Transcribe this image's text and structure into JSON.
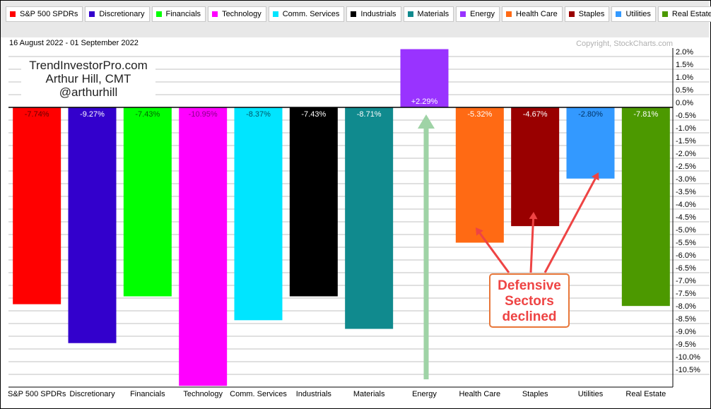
{
  "legend": [
    {
      "label": "S&P 500 SPDRs",
      "color": "#ff0000"
    },
    {
      "label": "Discretionary",
      "color": "#3300cc"
    },
    {
      "label": "Financials",
      "color": "#00ff00"
    },
    {
      "label": "Technology",
      "color": "#ff00ff"
    },
    {
      "label": "Comm. Services",
      "color": "#00e5ff"
    },
    {
      "label": "Industrials",
      "color": "#000000"
    },
    {
      "label": "Materials",
      "color": "#108a8e"
    },
    {
      "label": "Energy",
      "color": "#9933ff"
    },
    {
      "label": "Health Care",
      "color": "#ff6a14"
    },
    {
      "label": "Staples",
      "color": "#990000"
    },
    {
      "label": "Utilities",
      "color": "#3399ff"
    },
    {
      "label": "Real Estate",
      "color": "#4c9900"
    }
  ],
  "header": {
    "date_range": "16 August 2022 - 01 September 2022",
    "copyright": "Copyright, StockCharts.com"
  },
  "watermark": {
    "line1": "TrendInvestorPro.com",
    "line2": "Arthur Hill, CMT",
    "line3": "@arthurhill"
  },
  "annotation": {
    "line1": "Defensive",
    "line2": "Sectors",
    "line3": "declined",
    "color": "#ee4444"
  },
  "chart_data": {
    "type": "bar",
    "title": "",
    "xlabel": "",
    "ylabel": "",
    "categories": [
      "S&P 500 SPDRs",
      "Discretionary",
      "Financials",
      "Technology",
      "Comm. Services",
      "Industrials",
      "Materials",
      "Energy",
      "Health Care",
      "Staples",
      "Utilities",
      "Real Estate"
    ],
    "values": [
      -7.74,
      -9.27,
      -7.43,
      -10.95,
      -8.37,
      -7.43,
      -8.71,
      2.29,
      -5.32,
      -4.67,
      -2.8,
      -7.81
    ],
    "value_labels": [
      "-7.74%",
      "-9.27%",
      "-7.43%",
      "-10.95%",
      "-8.37%",
      "-7.43%",
      "-8.71%",
      "+2.29%",
      "-5.32%",
      "-4.67%",
      "-2.80%",
      "-7.81%"
    ],
    "label_colors": [
      "#660000",
      "#ffffff",
      "#006600",
      "#880088",
      "#005566",
      "#ffffff",
      "#ffffff",
      "#ffffff",
      "#ffffff",
      "#ffffff",
      "#003366",
      "#ffffff"
    ],
    "colors": [
      "#ff0000",
      "#3300cc",
      "#00ff00",
      "#ff00ff",
      "#00e5ff",
      "#000000",
      "#108a8e",
      "#9933ff",
      "#ff6a14",
      "#990000",
      "#3399ff",
      "#4c9900"
    ],
    "ylim": [
      -11.0,
      2.0
    ],
    "yticks": [
      2.0,
      1.5,
      1.0,
      0.5,
      0.0,
      -0.5,
      -1.0,
      -1.5,
      -2.0,
      -2.5,
      -3.0,
      -3.5,
      -4.0,
      -4.5,
      -5.0,
      -5.5,
      -6.0,
      -6.5,
      -7.0,
      -7.5,
      -8.0,
      -8.5,
      -9.0,
      -9.5,
      -10.0,
      -10.5
    ],
    "ytick_labels": [
      "2.0%",
      "1.5%",
      "1.0%",
      "0.5%",
      "0.0%",
      "-0.5%",
      "-1.0%",
      "-1.5%",
      "-2.0%",
      "-2.5%",
      "-3.0%",
      "-3.5%",
      "-4.0%",
      "-4.5%",
      "-5.0%",
      "-5.5%",
      "-6.0%",
      "-6.5%",
      "-7.0%",
      "-7.5%",
      "-8.0%",
      "-8.5%",
      "-9.0%",
      "-9.5%",
      "-10.0%",
      "-10.5%"
    ],
    "grid": true,
    "y_axis_position": "right",
    "legend_position": "top"
  }
}
